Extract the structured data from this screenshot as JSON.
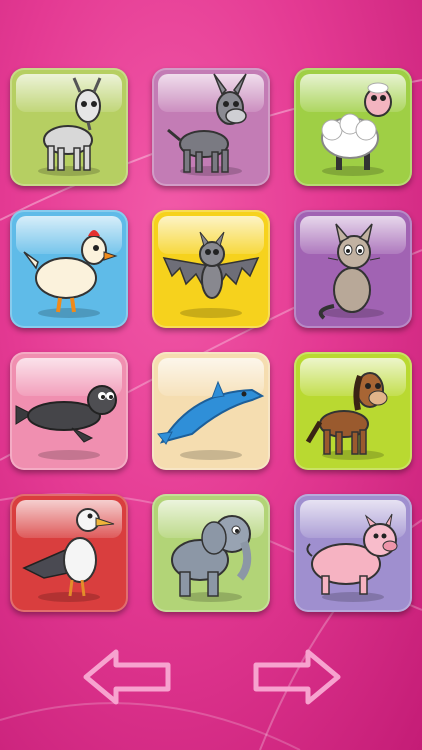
{
  "theme": {
    "background": "#e43a93",
    "arrow_outline": "#f7a3cf"
  },
  "tiles": [
    {
      "animal": "goat-icon",
      "color": "#b6cf62"
    },
    {
      "animal": "donkey-icon",
      "color": "#c37cb5"
    },
    {
      "animal": "sheep-icon",
      "color": "#9fcf45"
    },
    {
      "animal": "chicken-icon",
      "color": "#5fbbe8"
    },
    {
      "animal": "bat-icon",
      "color": "#f6d21d"
    },
    {
      "animal": "cat-icon",
      "color": "#a163b3"
    },
    {
      "animal": "seal-icon",
      "color": "#f08fb0"
    },
    {
      "animal": "dolphin-icon",
      "color": "#f5ddb0"
    },
    {
      "animal": "horse-icon",
      "color": "#b9d931"
    },
    {
      "animal": "seagull-icon",
      "color": "#d93e3e"
    },
    {
      "animal": "elephant-icon",
      "color": "#b2d477"
    },
    {
      "animal": "pig-icon",
      "color": "#9f8fcf"
    }
  ],
  "navigation": {
    "previous": "left-arrow-icon",
    "next": "right-arrow-icon"
  }
}
